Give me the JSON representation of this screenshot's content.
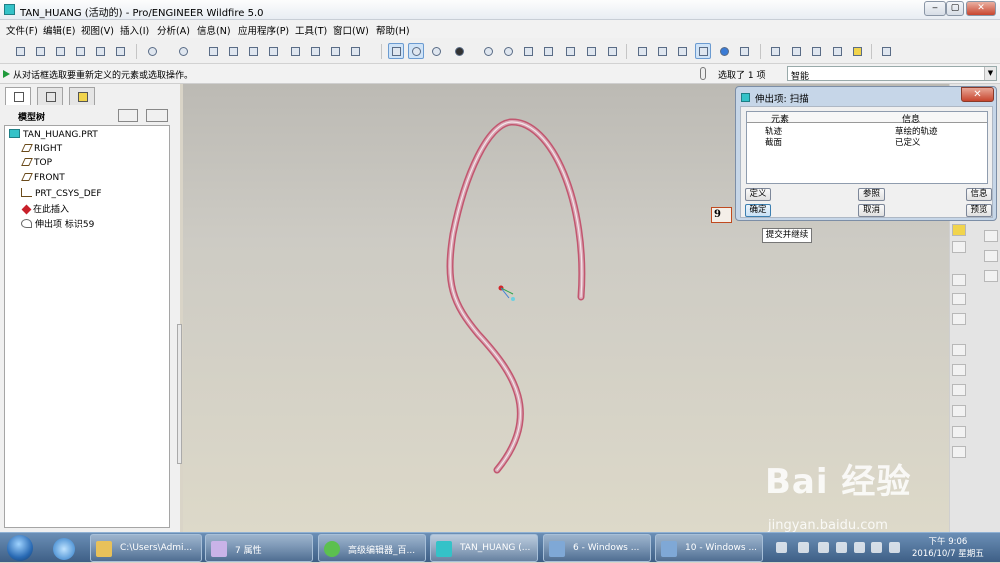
{
  "window": {
    "title": "TAN_HUANG (活动的) - Pro/ENGINEER Wildfire 5.0",
    "minimize": "‒",
    "restore": "▢",
    "close": "✕"
  },
  "menu": [
    "文件(F)",
    "编辑(E)",
    "视图(V)",
    "插入(I)",
    "分析(A)",
    "信息(N)",
    "应用程序(P)",
    "工具(T)",
    "窗口(W)",
    "帮助(H)"
  ],
  "message": {
    "text": "从对话框选取要重新定义的元素或选取操作。",
    "selected": "选取了 1 项",
    "filter": "智能"
  },
  "model_tree": {
    "title": "模型树",
    "items": [
      "TAN_HUANG.PRT",
      "RIGHT",
      "TOP",
      "FRONT",
      "PRT_CSYS_DEF",
      "在此插入",
      "伸出项 标识59"
    ]
  },
  "dialog": {
    "title": "伸出项: 扫描",
    "col_element": "元素",
    "col_info": "信息",
    "rows": [
      {
        "element": "轨迹",
        "info": "草绘的轨迹"
      },
      {
        "element": "截面",
        "info": "已定义"
      }
    ],
    "btn_define": "定义",
    "btn_ref": "参照",
    "btn_info": "信息",
    "btn_ok": "确定",
    "btn_cancel": "取消",
    "btn_preview": "预览",
    "close": "✕"
  },
  "tooltip": "提交并继续",
  "step_number": "9",
  "taskbar": {
    "items": [
      "C:\\Users\\Admi...",
      "7 属性",
      "高级编辑器_百...",
      "TAN_HUANG (...",
      "6 - Windows ...",
      "10 - Windows ..."
    ],
    "clock_time": "下午 9:06",
    "clock_date": "2016/10/7 星期五"
  },
  "watermark": {
    "brand": "Bai 经验",
    "url": "jingyan.baidu.com"
  },
  "colors": {
    "accent": "#34c2c8",
    "curve": "#c2566f",
    "curve_fill": "#d8a5b3",
    "background": "#cdcbc4"
  }
}
